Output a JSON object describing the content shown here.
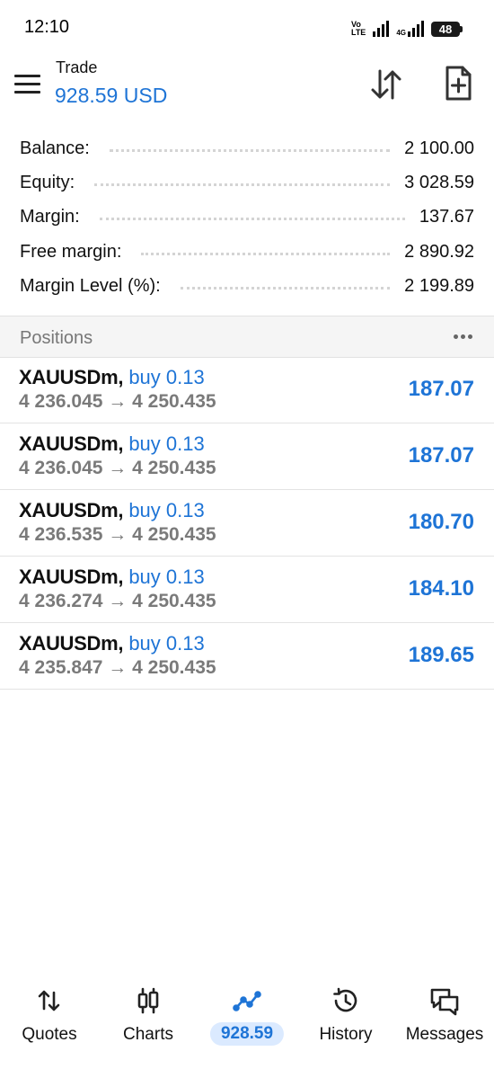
{
  "status_bar": {
    "time": "12:10",
    "volte_label": "Vo LTE",
    "network": "4G",
    "battery": "48"
  },
  "header": {
    "title": "Trade",
    "balance": "928.59 USD"
  },
  "summary": [
    {
      "label": "Balance:",
      "value": "2 100.00"
    },
    {
      "label": "Equity:",
      "value": "3 028.59"
    },
    {
      "label": "Margin:",
      "value": "137.67"
    },
    {
      "label": "Free margin:",
      "value": "2 890.92"
    },
    {
      "label": "Margin Level (%):",
      "value": "2 199.89"
    }
  ],
  "positions": {
    "title": "Positions",
    "items": [
      {
        "symbol": "XAUUSDm,",
        "side": "buy 0.13",
        "open": "4 236.045",
        "arrow": "→",
        "current": "4 250.435",
        "profit": "187.07"
      },
      {
        "symbol": "XAUUSDm,",
        "side": "buy 0.13",
        "open": "4 236.045",
        "arrow": "→",
        "current": "4 250.435",
        "profit": "187.07"
      },
      {
        "symbol": "XAUUSDm,",
        "side": "buy 0.13",
        "open": "4 236.535",
        "arrow": "→",
        "current": "4 250.435",
        "profit": "180.70"
      },
      {
        "symbol": "XAUUSDm,",
        "side": "buy 0.13",
        "open": "4 236.274",
        "arrow": "→",
        "current": "4 250.435",
        "profit": "184.10"
      },
      {
        "symbol": "XAUUSDm,",
        "side": "buy 0.13",
        "open": "4 235.847",
        "arrow": "→",
        "current": "4 250.435",
        "profit": "189.65"
      }
    ]
  },
  "bottom_nav": [
    {
      "label": "Quotes",
      "icon": "quotes-icon",
      "active": false
    },
    {
      "label": "Charts",
      "icon": "candlestick-icon",
      "active": false
    },
    {
      "label": "928.59",
      "icon": "trade-icon",
      "active": true
    },
    {
      "label": "History",
      "icon": "history-icon",
      "active": false
    },
    {
      "label": "Messages",
      "icon": "messages-icon",
      "active": false
    }
  ],
  "colors": {
    "accent": "#1e74d6",
    "muted": "#7a7a7a",
    "pill_bg": "#dbeaff",
    "section_bg": "#f5f5f5"
  }
}
